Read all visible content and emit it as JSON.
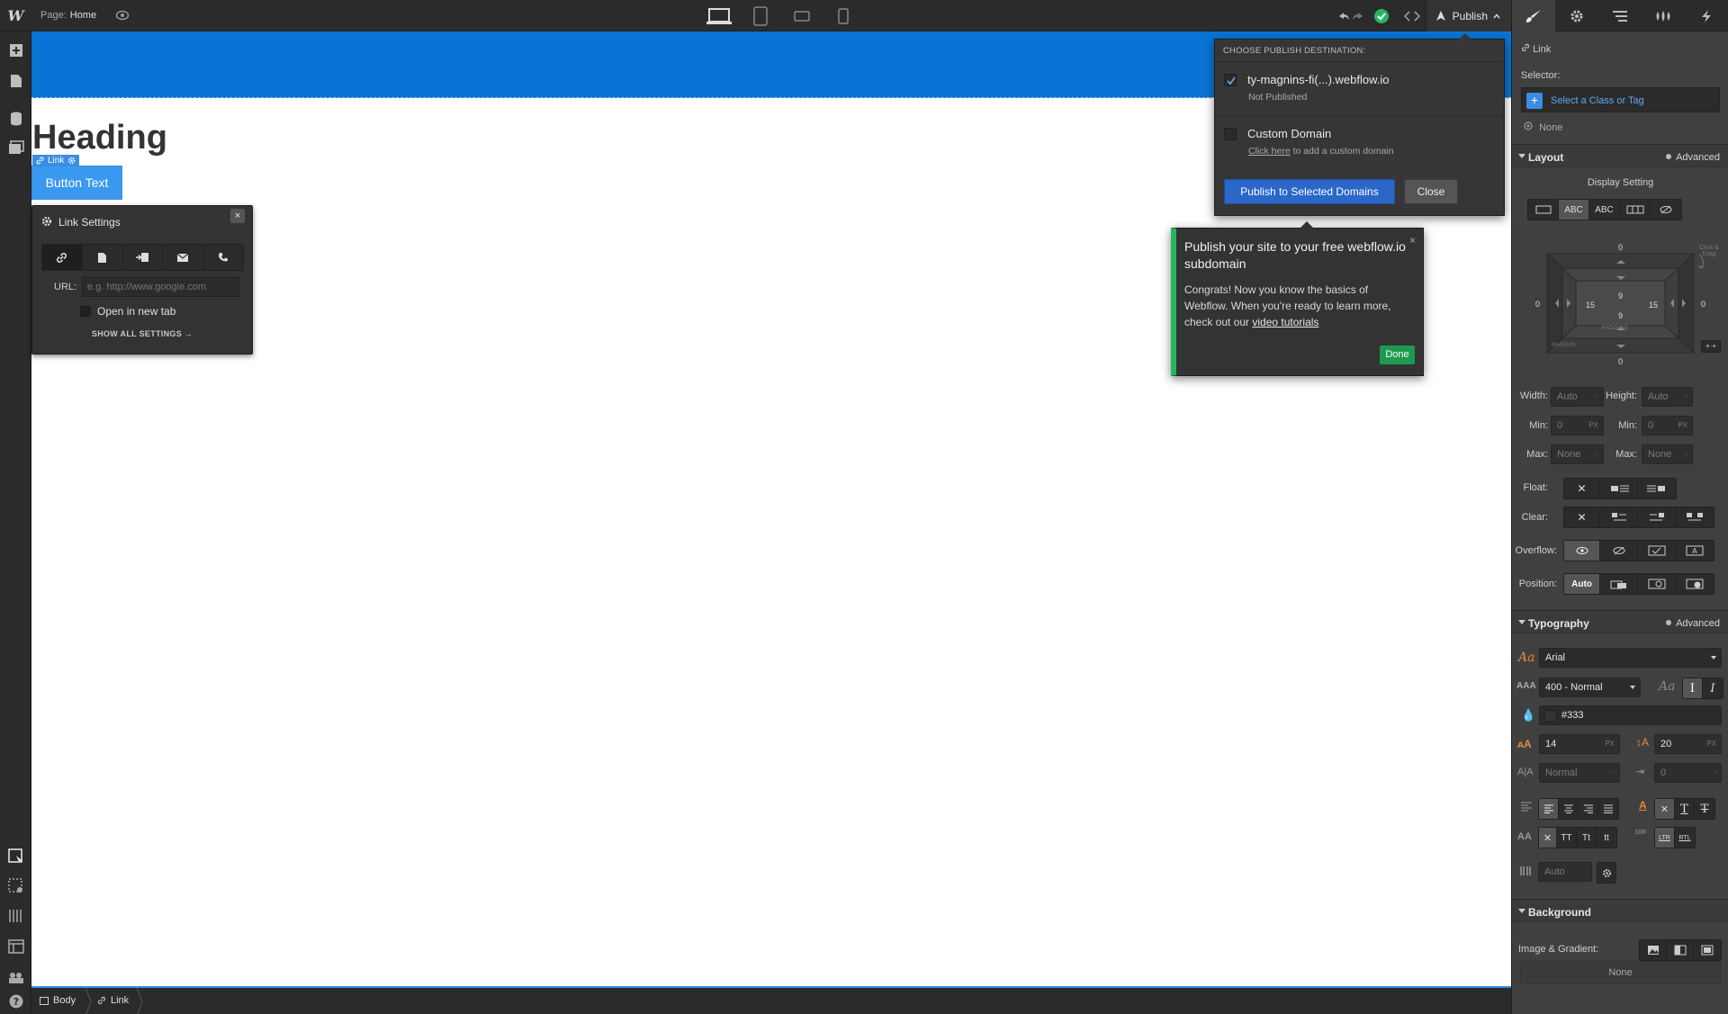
{
  "topbar": {
    "logo": "W",
    "page_label": "Page:",
    "page_name": "Home",
    "publish_label": "Publish"
  },
  "canvas": {
    "heading": "Heading",
    "link_tag": "Link",
    "button_text": "Button Text"
  },
  "breadcrumbs": [
    "Body",
    "Link"
  ],
  "link_settings": {
    "title": "Link Settings",
    "close": "×",
    "url_label": "URL:",
    "url_placeholder": "e.g. http://www.google.com",
    "new_tab_label": "Open in new tab",
    "show_all": "SHOW ALL SETTINGS →"
  },
  "publish_dropdown": {
    "heading": "CHOOSE PUBLISH DESTINATION:",
    "options": [
      {
        "name": "ty-magnins-fi(...).webflow.io",
        "sub": "Not Published",
        "checked": true
      },
      {
        "name": "Custom Domain",
        "sub_link": "Click here",
        "sub_rest": " to add a custom domain",
        "checked": false
      }
    ],
    "publish_button": "Publish to Selected Domains",
    "close_button": "Close"
  },
  "tooltip": {
    "title": "Publish your site to your free webflow.io subdomain",
    "body_pre": "Congrats! Now you know the basics of Webflow. When you're ready to learn more, check out our ",
    "body_link": "video tutorials",
    "close": "×",
    "done": "Done",
    "accent": "#27b561"
  },
  "right_panel": {
    "element": "Link",
    "selector_label": "Selector:",
    "selector_placeholder": "Select a Class or Tag",
    "none": "None",
    "layout": {
      "title": "Layout",
      "advanced": "Advanced",
      "display_setting": "Display Setting",
      "display_options": [
        "",
        "ABC",
        "ABC",
        "",
        ""
      ],
      "box": {
        "margin_top": "0",
        "margin_bottom": "0",
        "margin_left": "0",
        "margin_right": "0",
        "padding_top": "9",
        "padding_bottom": "9",
        "padding_left": "15",
        "padding_right": "15",
        "padding_label": "PADDING",
        "margin_label": "MARGIN",
        "hint": "Click & Drag"
      },
      "width_label": "Width:",
      "width": "Auto",
      "height_label": "Height:",
      "height": "Auto",
      "min_label": "Min:",
      "min_w": "0",
      "min_h": "0",
      "unit": "PX",
      "max_label": "Max:",
      "max_w": "None",
      "max_h": "None",
      "float_label": "Float:",
      "clear_label": "Clear:",
      "overflow_label": "Overflow:",
      "position_label": "Position:",
      "position_auto": "Auto"
    },
    "typography": {
      "title": "Typography",
      "advanced": "Advanced",
      "font": "Arial",
      "weight": "400 - Normal",
      "color": "#333",
      "size": "14",
      "line_height": "20",
      "letter_spacing": "Normal",
      "text_indent": "0",
      "columns": "Auto",
      "tt_options": [
        "TT",
        "Tt",
        "tt"
      ],
      "dir_options": [
        "DIR",
        "LTR",
        "RTL"
      ]
    },
    "background": {
      "title": "Background",
      "image_label": "Image & Gradient:",
      "none": "None"
    }
  },
  "colors": {
    "accent_blue": "#3a8de3",
    "navbar_blue": "#0a74d6",
    "publish_blue": "#2a67c9",
    "done_green": "#1d9a50"
  }
}
